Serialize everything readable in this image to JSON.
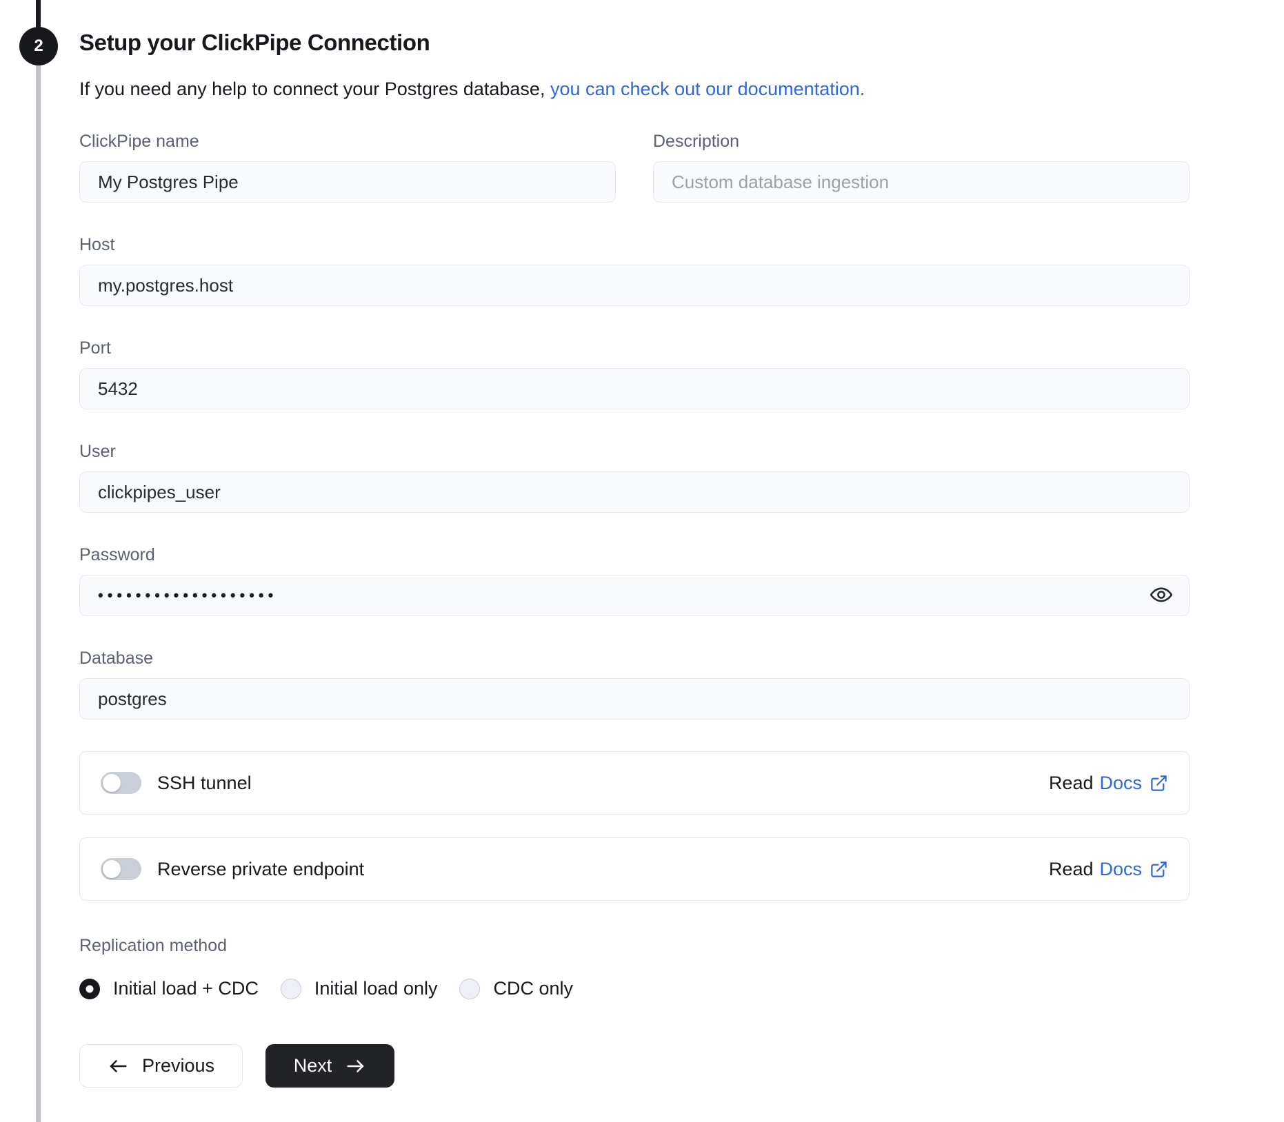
{
  "stepper": {
    "step_number": "2"
  },
  "header": {
    "title": "Setup your ClickPipe Connection",
    "subtitle_text": "If you need any help to connect your Postgres database,",
    "subtitle_link": "you can check out our documentation."
  },
  "form": {
    "fields": {
      "clickpipe_name": {
        "label": "ClickPipe name",
        "value": "My Postgres Pipe"
      },
      "description": {
        "label": "Description",
        "placeholder": "Custom database ingestion"
      },
      "host": {
        "label": "Host",
        "value": "my.postgres.host"
      },
      "port": {
        "label": "Port",
        "value": "5432"
      },
      "user": {
        "label": "User",
        "value": "clickpipes_user"
      },
      "password": {
        "label": "Password",
        "value_masked": "•••••••••••••••••••"
      },
      "database": {
        "label": "Database",
        "value": "postgres"
      }
    },
    "toggles": [
      {
        "label": "SSH tunnel",
        "state": "off",
        "read_text": "Read",
        "docs_text": "Docs"
      },
      {
        "label": "Reverse private endpoint",
        "state": "off",
        "read_text": "Read",
        "docs_text": "Docs"
      }
    ],
    "replication": {
      "label": "Replication method",
      "options": [
        {
          "label": "Initial load + CDC",
          "selected": true
        },
        {
          "label": "Initial load only",
          "selected": false
        },
        {
          "label": "CDC only",
          "selected": false
        }
      ]
    },
    "buttons": {
      "previous": "Previous",
      "next": "Next"
    }
  },
  "icons": {
    "eye": "password-visibility-eye",
    "external_link": "open-docs-external",
    "arrow_left": "previous-arrow",
    "arrow_right": "next-arrow"
  },
  "colors": {
    "accent_link": "#2e68db",
    "step_badge": "#17181c",
    "next_button_bg": "#222327",
    "input_bg": "#f9fafd",
    "input_border": "#e6e8ee",
    "toggle_track_off": "#c9ced7"
  }
}
